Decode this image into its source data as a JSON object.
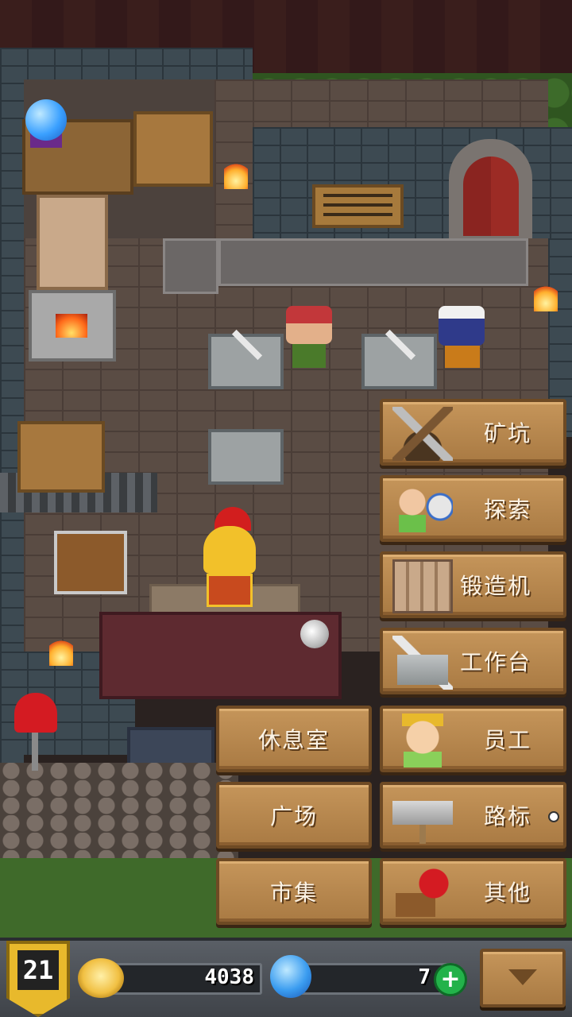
{
  "menu": {
    "mine": "矿坑",
    "explore": "探索",
    "forge": "锻造机",
    "workbench": "工作台",
    "staff": "员工",
    "signpost": "路标",
    "other": "其他",
    "lounge": "休息室",
    "plaza": "广场",
    "market": "市集"
  },
  "status": {
    "level": "21",
    "gold": "4038",
    "gems": "7",
    "add_symbol": "+"
  },
  "icons": {
    "coin": "gold-coin-icon",
    "gem": "blue-gem-icon",
    "add": "plus-icon",
    "collapse": "triangle-down-icon"
  },
  "colors": {
    "menu_wood": "#b88748",
    "menu_border": "#6e4a24",
    "level_badge": "#e8b92c",
    "plus_button": "#23b24a"
  }
}
